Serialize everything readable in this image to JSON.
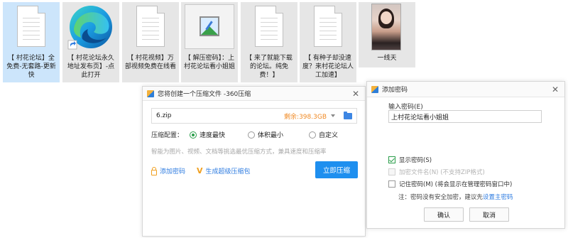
{
  "files": [
    {
      "label": "【 村花论坛】全免费-无套路-更新快",
      "selected": true,
      "icon": "document-icon"
    },
    {
      "label": "【 村花论坛永久地址发布页】-点此打开",
      "icon": "edge-shortcut-icon"
    },
    {
      "label": "【 村花视频】万部视频免费在线看",
      "icon": "document-icon"
    },
    {
      "label": "【 解压密码】：上村花论坛看小姐姐",
      "icon": "image-file-icon"
    },
    {
      "label": "【 来了就能下载的论坛。纯免费！】",
      "icon": "document-icon"
    },
    {
      "label": "【 有种子却没速度？来村花论坛人工加速】",
      "icon": "document-icon"
    },
    {
      "label": "一线天",
      "icon": "photo-thumbnail"
    }
  ],
  "compress_dialog": {
    "title": "您将创建一个压缩文件 -360压缩",
    "filename": "6.zip",
    "free_space": "剩余:398.3GB",
    "config_label": "压缩配置：",
    "options": [
      "速度最快",
      "体积最小",
      "自定义"
    ],
    "selected_option": "速度最快",
    "hint": "智能为图片、视频、文档等挑选最优压缩方式，兼具速度和压缩率",
    "add_password": "添加密码",
    "super_pack": "生成超级压缩包",
    "start_button": "立即压缩",
    "accent_color": "#1e8fef"
  },
  "password_dialog": {
    "title": "添加密码",
    "input_label": "输入密码(E)",
    "password_value": "上村花论坛看小姐姐",
    "show_password": "显示密码(S)",
    "encrypt_filenames": "加密文件名(N) (不支持ZIP格式)",
    "remember_password": "记住密码(M) (将会显示在管理密码窗口中)",
    "note_prefix": "注：密码没有安全加密，建议先",
    "note_link": "设置主密码",
    "ok": "确认",
    "cancel": "取消"
  }
}
